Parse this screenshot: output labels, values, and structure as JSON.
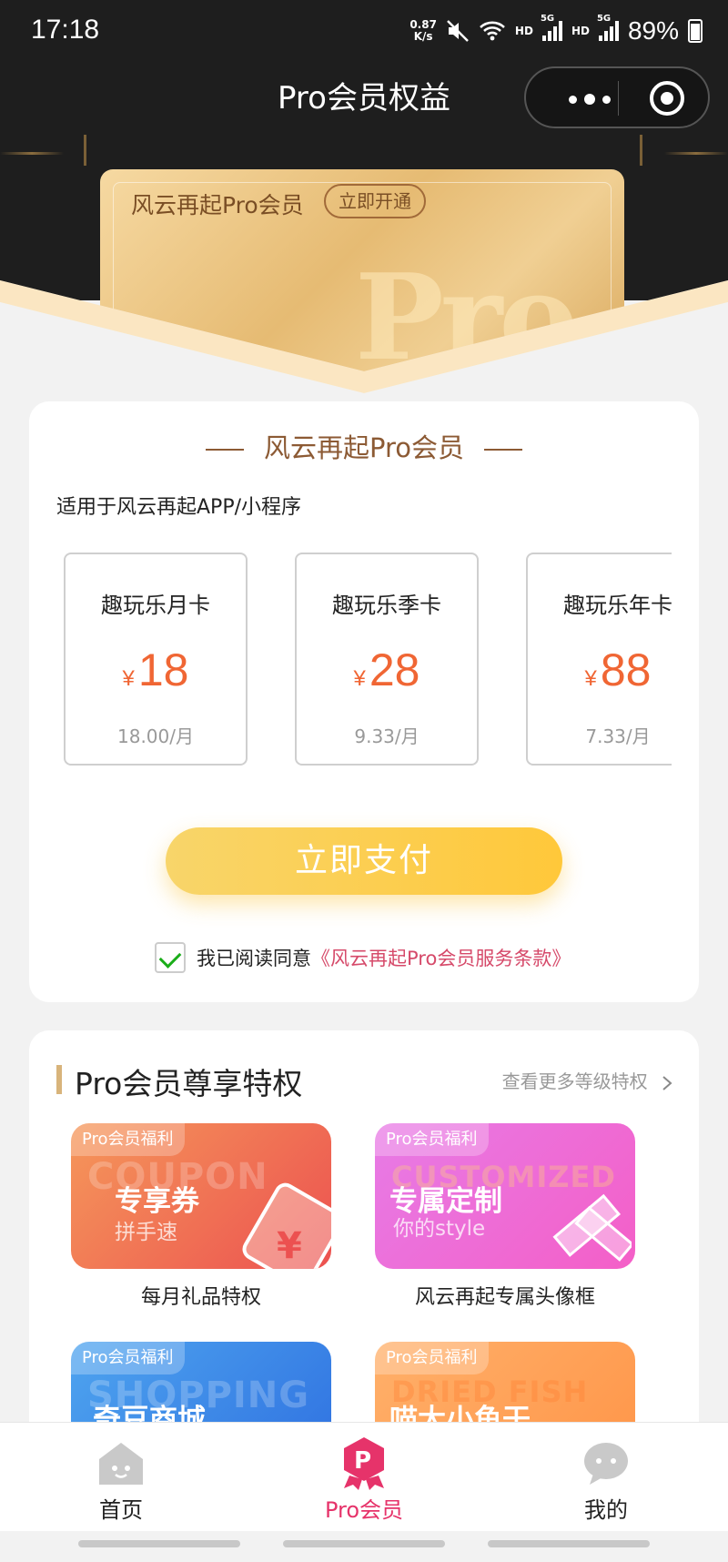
{
  "status_bar": {
    "time": "17:18",
    "net_speed_value": "0.87",
    "net_speed_unit": "K/s",
    "hd1": "HD",
    "hd2": "HD",
    "sig1": "5G",
    "sig2": "5G",
    "battery": "89%"
  },
  "nav": {
    "title": "Pro会员权益"
  },
  "pro_card": {
    "title": "风云再起Pro会员",
    "open_button": "立即开通",
    "watermark": "Pro"
  },
  "membership": {
    "section_title": "风云再起Pro会员",
    "applies_to": "适用于风云再起APP/小程序",
    "currency": "¥",
    "plans": [
      {
        "name": "趣玩乐月卡",
        "price": "18",
        "per_month": "18.00/月"
      },
      {
        "name": "趣玩乐季卡",
        "price": "28",
        "per_month": "9.33/月"
      },
      {
        "name": "趣玩乐年卡",
        "price": "88",
        "per_month": "7.33/月"
      }
    ],
    "pay_button": "立即支付",
    "agree_text": "我已阅读同意",
    "agree_link": "《风云再起Pro会员服务条款》",
    "agreed": true
  },
  "privileges": {
    "title": "Pro会员尊享特权",
    "more_link": "查看更多等级特权",
    "items": [
      {
        "tag": "Pro会员福利",
        "ghost": "COUPON",
        "main": "专享券",
        "sub": "拼手速",
        "caption": "每月礼品特权",
        "color": "#ec5150"
      },
      {
        "tag": "Pro会员福利",
        "ghost": "CUSTOMIZED",
        "main": "专属定制",
        "sub": "你的style",
        "caption": "风云再起专属头像框",
        "color": "#f45fc7"
      },
      {
        "tag": "Pro会员福利",
        "ghost": "SHOPPING",
        "main": "奇豆商城",
        "sub": "",
        "caption": "",
        "color": "#2e6fe0"
      },
      {
        "tag": "Pro会员福利",
        "ghost": "DRIED FISH",
        "main": "喵大小鱼干",
        "sub": "",
        "caption": "",
        "color": "#ff9447"
      }
    ]
  },
  "tabbar": {
    "tabs": [
      {
        "label": "首页",
        "icon": "home-icon",
        "active": false
      },
      {
        "label": "Pro会员",
        "icon": "pro-member-icon",
        "active": true
      },
      {
        "label": "我的",
        "icon": "profile-icon",
        "active": false
      }
    ]
  },
  "colors": {
    "accent_gold": "#8c5a34",
    "price_orange": "#f06634",
    "pay_yellow": "#ffc83a",
    "link_pink": "#d64a6a",
    "active_tab": "#e6336a"
  }
}
